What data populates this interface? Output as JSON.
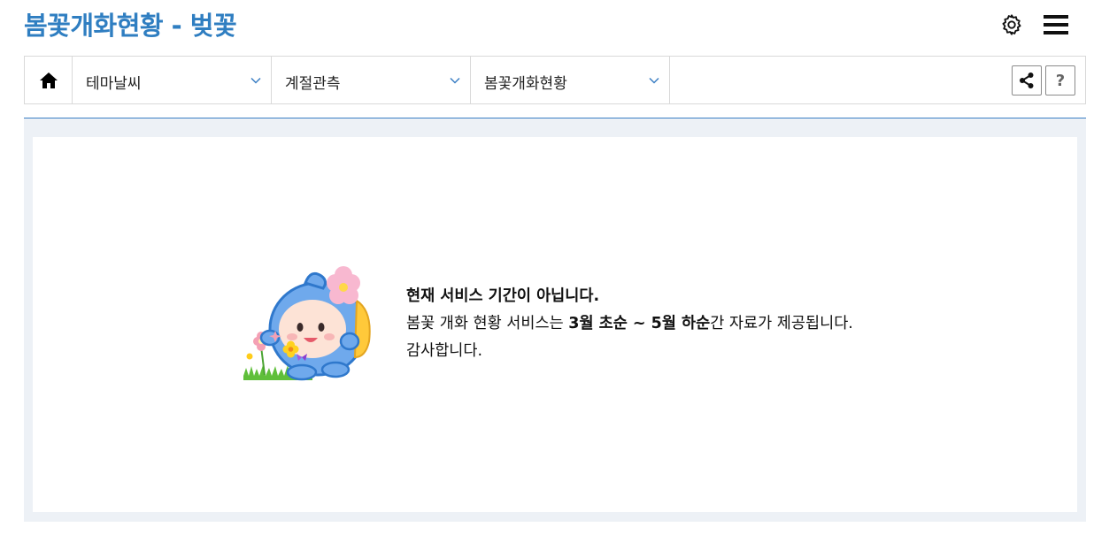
{
  "header": {
    "title": "봄꽃개화현황 - 벚꽃",
    "settings_icon": "gear-icon",
    "menu_icon": "hamburger-menu-icon"
  },
  "nav": {
    "home_icon": "home-icon",
    "items": [
      {
        "label": "테마날씨"
      },
      {
        "label": "계절관측"
      },
      {
        "label": "봄꽃개화현황"
      }
    ],
    "share_icon": "share-icon",
    "help_label": "?"
  },
  "notice": {
    "title": "현재 서비스 기간이 아닙니다.",
    "line2_prefix": "봄꽃 개화 현황 서비스는 ",
    "line2_bold": "3월 초순 ~ 5월 하순",
    "line2_suffix": "간 자료가 제공됩니다.",
    "line3": "감사합니다."
  },
  "colors": {
    "title": "#2f7ec1",
    "accent_rule": "#3b7fc4",
    "content_bg": "#edf1f6",
    "chevron": "#3b7fc4"
  }
}
